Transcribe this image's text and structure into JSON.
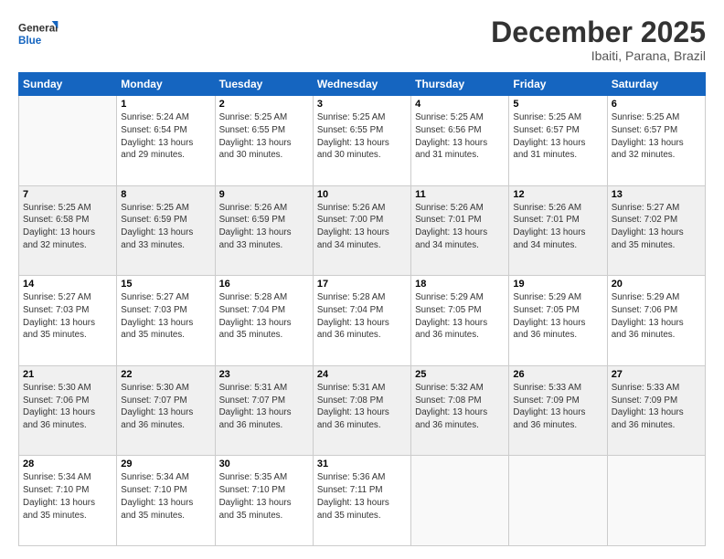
{
  "logo": {
    "line1": "General",
    "line2": "Blue"
  },
  "title": "December 2025",
  "subtitle": "Ibaiti, Parana, Brazil",
  "weekdays": [
    "Sunday",
    "Monday",
    "Tuesday",
    "Wednesday",
    "Thursday",
    "Friday",
    "Saturday"
  ],
  "weeks": [
    [
      {
        "day": "",
        "info": ""
      },
      {
        "day": "1",
        "info": "Sunrise: 5:24 AM\nSunset: 6:54 PM\nDaylight: 13 hours\nand 29 minutes."
      },
      {
        "day": "2",
        "info": "Sunrise: 5:25 AM\nSunset: 6:55 PM\nDaylight: 13 hours\nand 30 minutes."
      },
      {
        "day": "3",
        "info": "Sunrise: 5:25 AM\nSunset: 6:55 PM\nDaylight: 13 hours\nand 30 minutes."
      },
      {
        "day": "4",
        "info": "Sunrise: 5:25 AM\nSunset: 6:56 PM\nDaylight: 13 hours\nand 31 minutes."
      },
      {
        "day": "5",
        "info": "Sunrise: 5:25 AM\nSunset: 6:57 PM\nDaylight: 13 hours\nand 31 minutes."
      },
      {
        "day": "6",
        "info": "Sunrise: 5:25 AM\nSunset: 6:57 PM\nDaylight: 13 hours\nand 32 minutes."
      }
    ],
    [
      {
        "day": "7",
        "info": "Sunrise: 5:25 AM\nSunset: 6:58 PM\nDaylight: 13 hours\nand 32 minutes."
      },
      {
        "day": "8",
        "info": "Sunrise: 5:25 AM\nSunset: 6:59 PM\nDaylight: 13 hours\nand 33 minutes."
      },
      {
        "day": "9",
        "info": "Sunrise: 5:26 AM\nSunset: 6:59 PM\nDaylight: 13 hours\nand 33 minutes."
      },
      {
        "day": "10",
        "info": "Sunrise: 5:26 AM\nSunset: 7:00 PM\nDaylight: 13 hours\nand 34 minutes."
      },
      {
        "day": "11",
        "info": "Sunrise: 5:26 AM\nSunset: 7:01 PM\nDaylight: 13 hours\nand 34 minutes."
      },
      {
        "day": "12",
        "info": "Sunrise: 5:26 AM\nSunset: 7:01 PM\nDaylight: 13 hours\nand 34 minutes."
      },
      {
        "day": "13",
        "info": "Sunrise: 5:27 AM\nSunset: 7:02 PM\nDaylight: 13 hours\nand 35 minutes."
      }
    ],
    [
      {
        "day": "14",
        "info": "Sunrise: 5:27 AM\nSunset: 7:03 PM\nDaylight: 13 hours\nand 35 minutes."
      },
      {
        "day": "15",
        "info": "Sunrise: 5:27 AM\nSunset: 7:03 PM\nDaylight: 13 hours\nand 35 minutes."
      },
      {
        "day": "16",
        "info": "Sunrise: 5:28 AM\nSunset: 7:04 PM\nDaylight: 13 hours\nand 35 minutes."
      },
      {
        "day": "17",
        "info": "Sunrise: 5:28 AM\nSunset: 7:04 PM\nDaylight: 13 hours\nand 36 minutes."
      },
      {
        "day": "18",
        "info": "Sunrise: 5:29 AM\nSunset: 7:05 PM\nDaylight: 13 hours\nand 36 minutes."
      },
      {
        "day": "19",
        "info": "Sunrise: 5:29 AM\nSunset: 7:05 PM\nDaylight: 13 hours\nand 36 minutes."
      },
      {
        "day": "20",
        "info": "Sunrise: 5:29 AM\nSunset: 7:06 PM\nDaylight: 13 hours\nand 36 minutes."
      }
    ],
    [
      {
        "day": "21",
        "info": "Sunrise: 5:30 AM\nSunset: 7:06 PM\nDaylight: 13 hours\nand 36 minutes."
      },
      {
        "day": "22",
        "info": "Sunrise: 5:30 AM\nSunset: 7:07 PM\nDaylight: 13 hours\nand 36 minutes."
      },
      {
        "day": "23",
        "info": "Sunrise: 5:31 AM\nSunset: 7:07 PM\nDaylight: 13 hours\nand 36 minutes."
      },
      {
        "day": "24",
        "info": "Sunrise: 5:31 AM\nSunset: 7:08 PM\nDaylight: 13 hours\nand 36 minutes."
      },
      {
        "day": "25",
        "info": "Sunrise: 5:32 AM\nSunset: 7:08 PM\nDaylight: 13 hours\nand 36 minutes."
      },
      {
        "day": "26",
        "info": "Sunrise: 5:33 AM\nSunset: 7:09 PM\nDaylight: 13 hours\nand 36 minutes."
      },
      {
        "day": "27",
        "info": "Sunrise: 5:33 AM\nSunset: 7:09 PM\nDaylight: 13 hours\nand 36 minutes."
      }
    ],
    [
      {
        "day": "28",
        "info": "Sunrise: 5:34 AM\nSunset: 7:10 PM\nDaylight: 13 hours\nand 35 minutes."
      },
      {
        "day": "29",
        "info": "Sunrise: 5:34 AM\nSunset: 7:10 PM\nDaylight: 13 hours\nand 35 minutes."
      },
      {
        "day": "30",
        "info": "Sunrise: 5:35 AM\nSunset: 7:10 PM\nDaylight: 13 hours\nand 35 minutes."
      },
      {
        "day": "31",
        "info": "Sunrise: 5:36 AM\nSunset: 7:11 PM\nDaylight: 13 hours\nand 35 minutes."
      },
      {
        "day": "",
        "info": ""
      },
      {
        "day": "",
        "info": ""
      },
      {
        "day": "",
        "info": ""
      }
    ]
  ]
}
